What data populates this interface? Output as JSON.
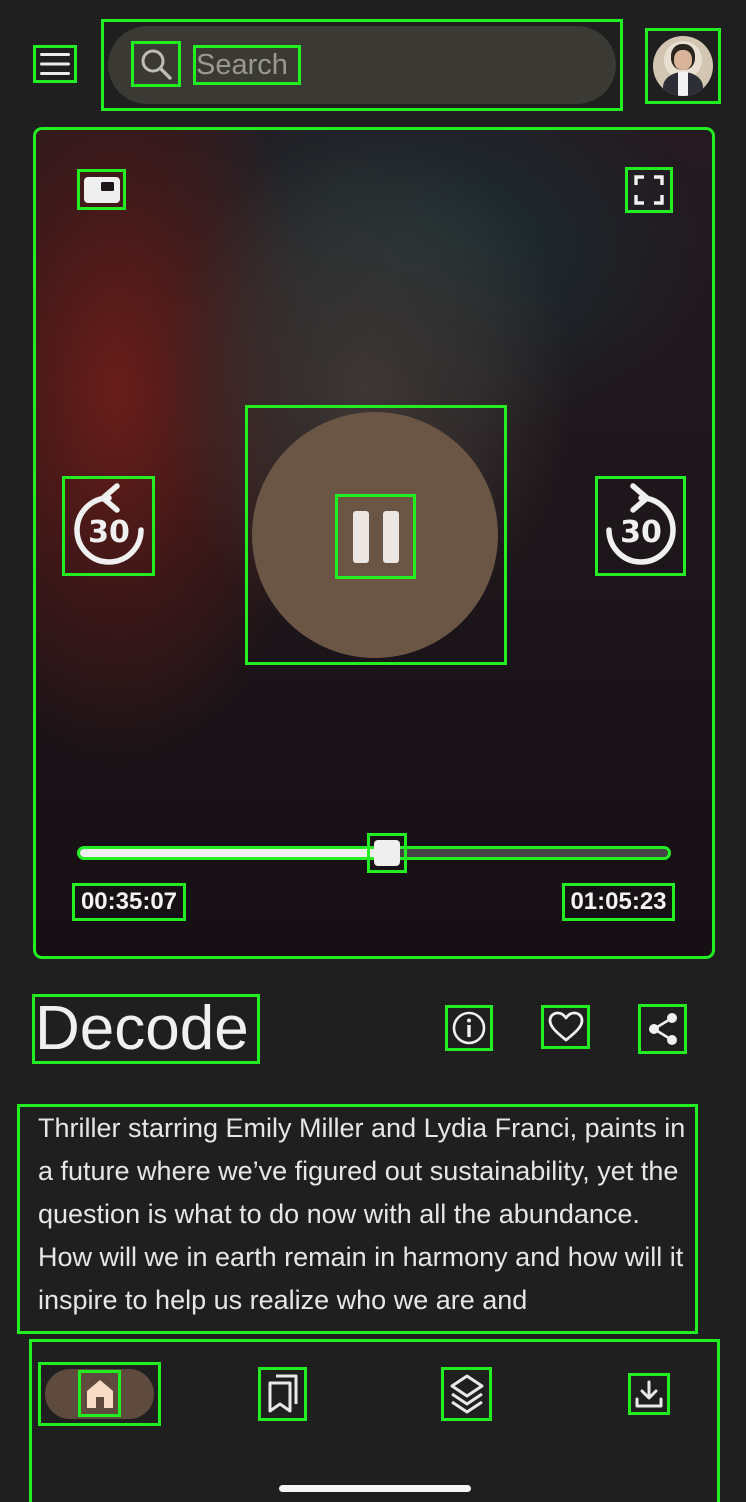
{
  "header": {
    "search_placeholder": "Search",
    "icons": {
      "menu": "menu-icon",
      "search": "search-icon",
      "avatar": "user-avatar"
    }
  },
  "player": {
    "current_time": "00:35:07",
    "total_time": "01:05:23",
    "progress": 0.522,
    "rewind_label": "30",
    "forward_label": "30",
    "state": "playing",
    "icons": {
      "pip": "picture-in-picture-icon",
      "fullscreen": "fullscreen-icon",
      "rewind": "replay-30-icon",
      "forward": "forward-30-icon",
      "pause": "pause-icon"
    }
  },
  "episode": {
    "title": "Decode",
    "description": "Thriller starring Emily Miller and Lydia Franci, paints in a future where we’ve figured out sustainability, yet the question is what to do now with all the abundance. How will we in earth remain in harmony and how will it inspire to help us realize who we are and",
    "actions": [
      "info-icon",
      "heart-icon",
      "share-icon"
    ]
  },
  "nav": {
    "items": [
      {
        "icon": "home-icon",
        "active": true
      },
      {
        "icon": "library-icon",
        "active": false
      },
      {
        "icon": "layers-icon",
        "active": false
      },
      {
        "icon": "download-icon",
        "active": false
      }
    ]
  },
  "colors": {
    "background": "#1f1f1f",
    "accent": "#6b5646",
    "nav_active_pill": "#5e4b3e",
    "search_pill": "#3a3933"
  }
}
